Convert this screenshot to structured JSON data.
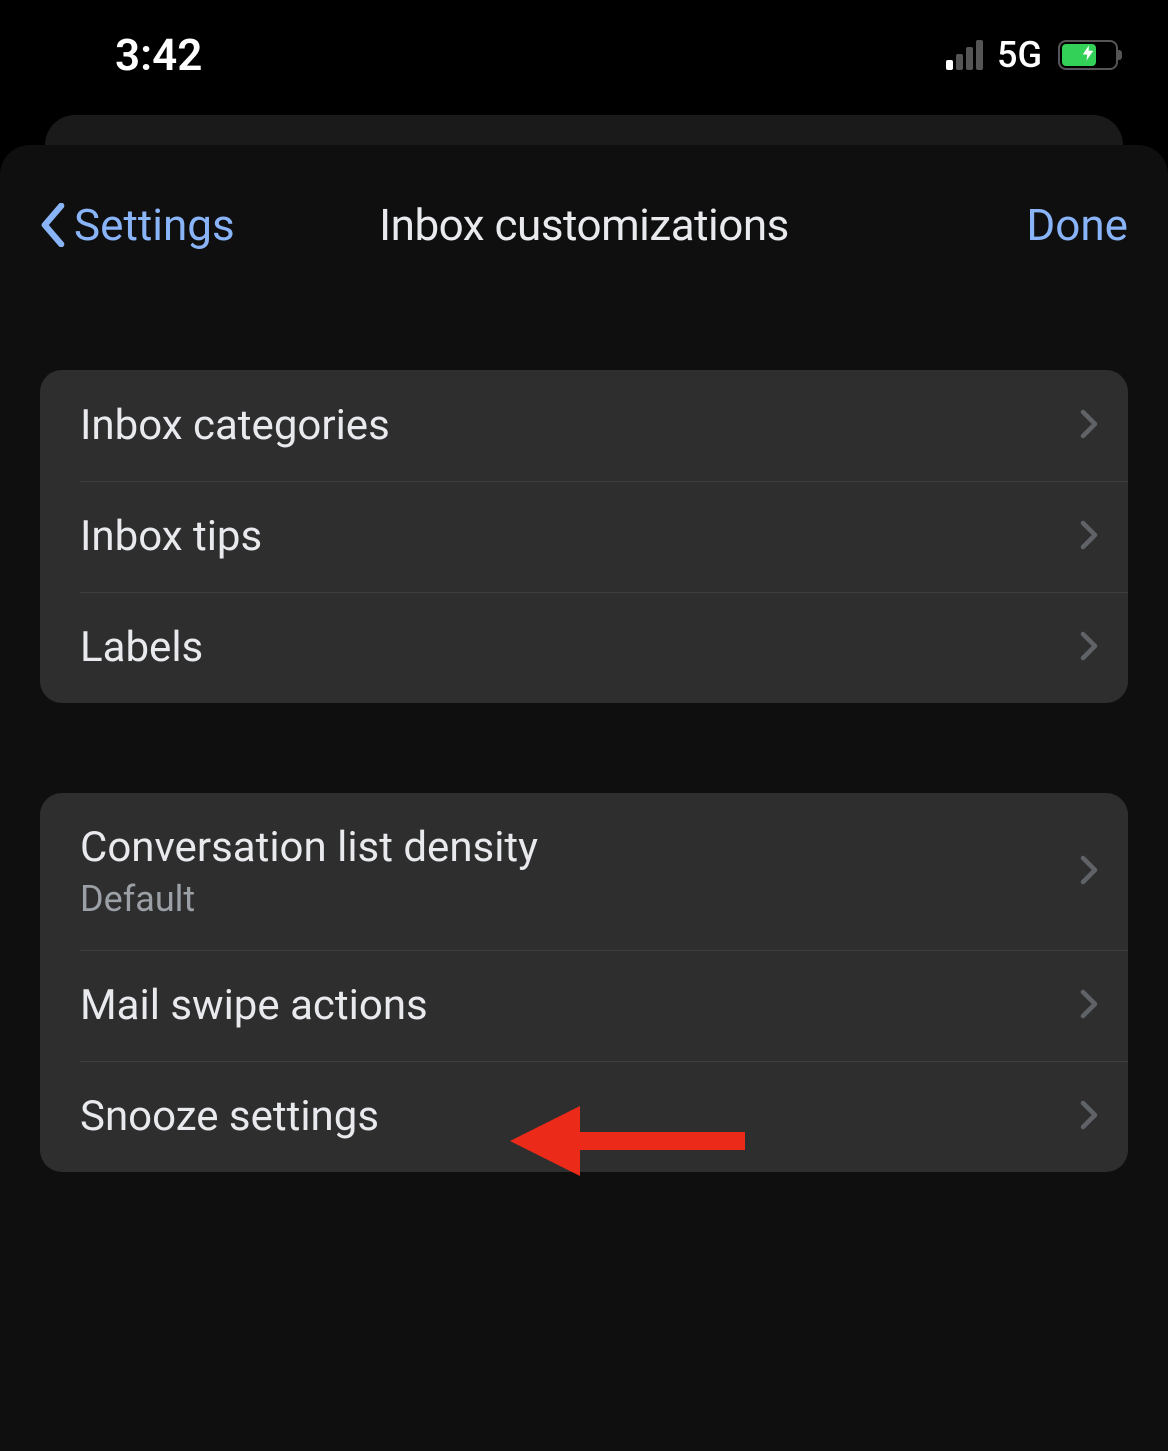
{
  "status": {
    "time": "3:42",
    "network": "5G"
  },
  "nav": {
    "back_label": "Settings",
    "title": "Inbox customizations",
    "done_label": "Done"
  },
  "group1": {
    "items": [
      {
        "label": "Inbox categories"
      },
      {
        "label": "Inbox tips"
      },
      {
        "label": "Labels"
      }
    ]
  },
  "group2": {
    "items": [
      {
        "label": "Conversation list density",
        "sub": "Default"
      },
      {
        "label": "Mail swipe actions"
      },
      {
        "label": "Snooze settings"
      }
    ]
  }
}
